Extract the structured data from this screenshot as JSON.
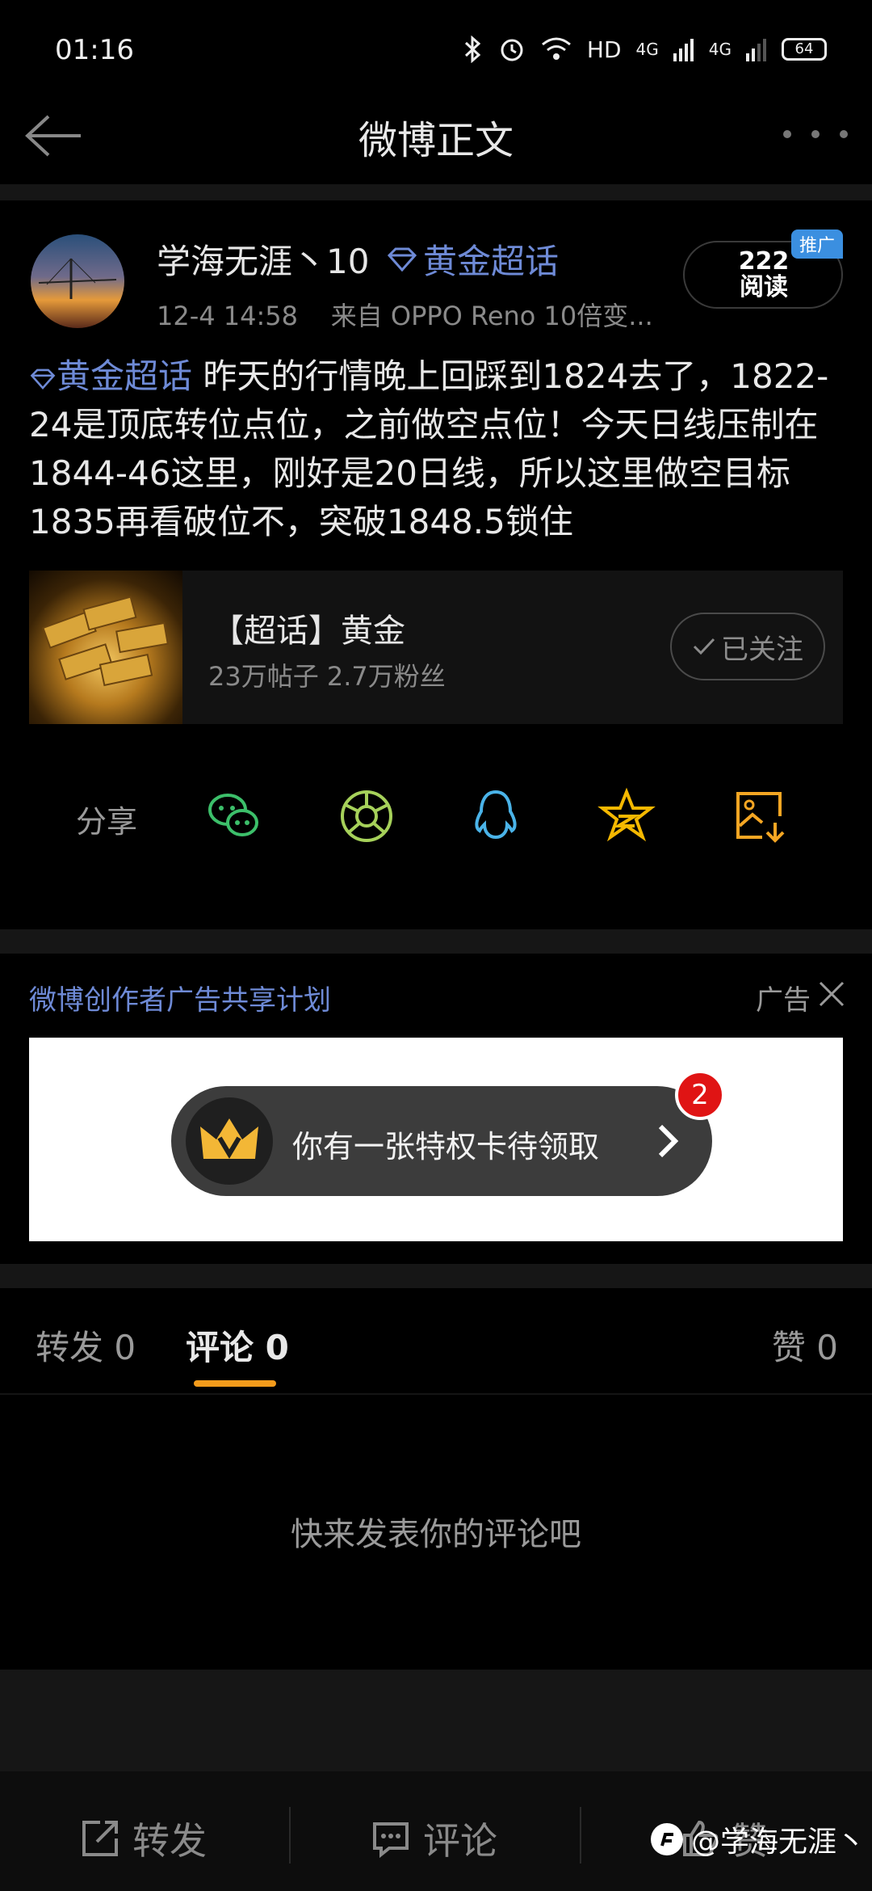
{
  "status_bar": {
    "time": "01:16",
    "indicators": [
      "bluetooth-icon",
      "alarm-icon",
      "wifi-icon",
      "HD",
      "4G",
      "4G"
    ],
    "hd_label": "HD",
    "net1": "4G",
    "net2": "4G",
    "battery": "64"
  },
  "header": {
    "title": "微博正文"
  },
  "post": {
    "author": "学海无涯丶10",
    "topic_badge": "黄金超话",
    "time": "12-4 14:58",
    "source": "来自 OPPO Reno 10倍变...",
    "read_count": "222",
    "read_label": "阅读",
    "promo_tag": "推广",
    "text_topic": "黄金超话",
    "text_body": " 昨天的行情晚上回踩到1824去了，1822-24是顶底转位点位，之前做空点位！今天日线压制在1844-46这里，刚好是20日线，所以这里做空目标1835再看破位不，突破1848.5锁住"
  },
  "topic_card": {
    "title": "【超话】黄金",
    "stats": "23万帖子 2.7万粉丝",
    "follow_label": "已关注"
  },
  "share": {
    "label": "分享",
    "targets": [
      "wechat-icon",
      "moments-icon",
      "qq-icon",
      "qzone-icon",
      "save-image-icon"
    ]
  },
  "ad": {
    "label": "微博创作者广告共享计划",
    "tag": "广告",
    "banner_text": "你有一张特权卡待领取",
    "badge_count": "2"
  },
  "tabs": {
    "repost": "转发 0",
    "comment": "评论 0",
    "like": "赞 0"
  },
  "empty_hint": "快来发表你的评论吧",
  "bottom_bar": {
    "repost": "转发",
    "comment": "评论",
    "like": "赞",
    "watermark": "@学海无涯丶"
  },
  "colors": {
    "accent_blue": "#6e8ad6",
    "tab_underline": "#f39b1b",
    "background": "#000000"
  }
}
